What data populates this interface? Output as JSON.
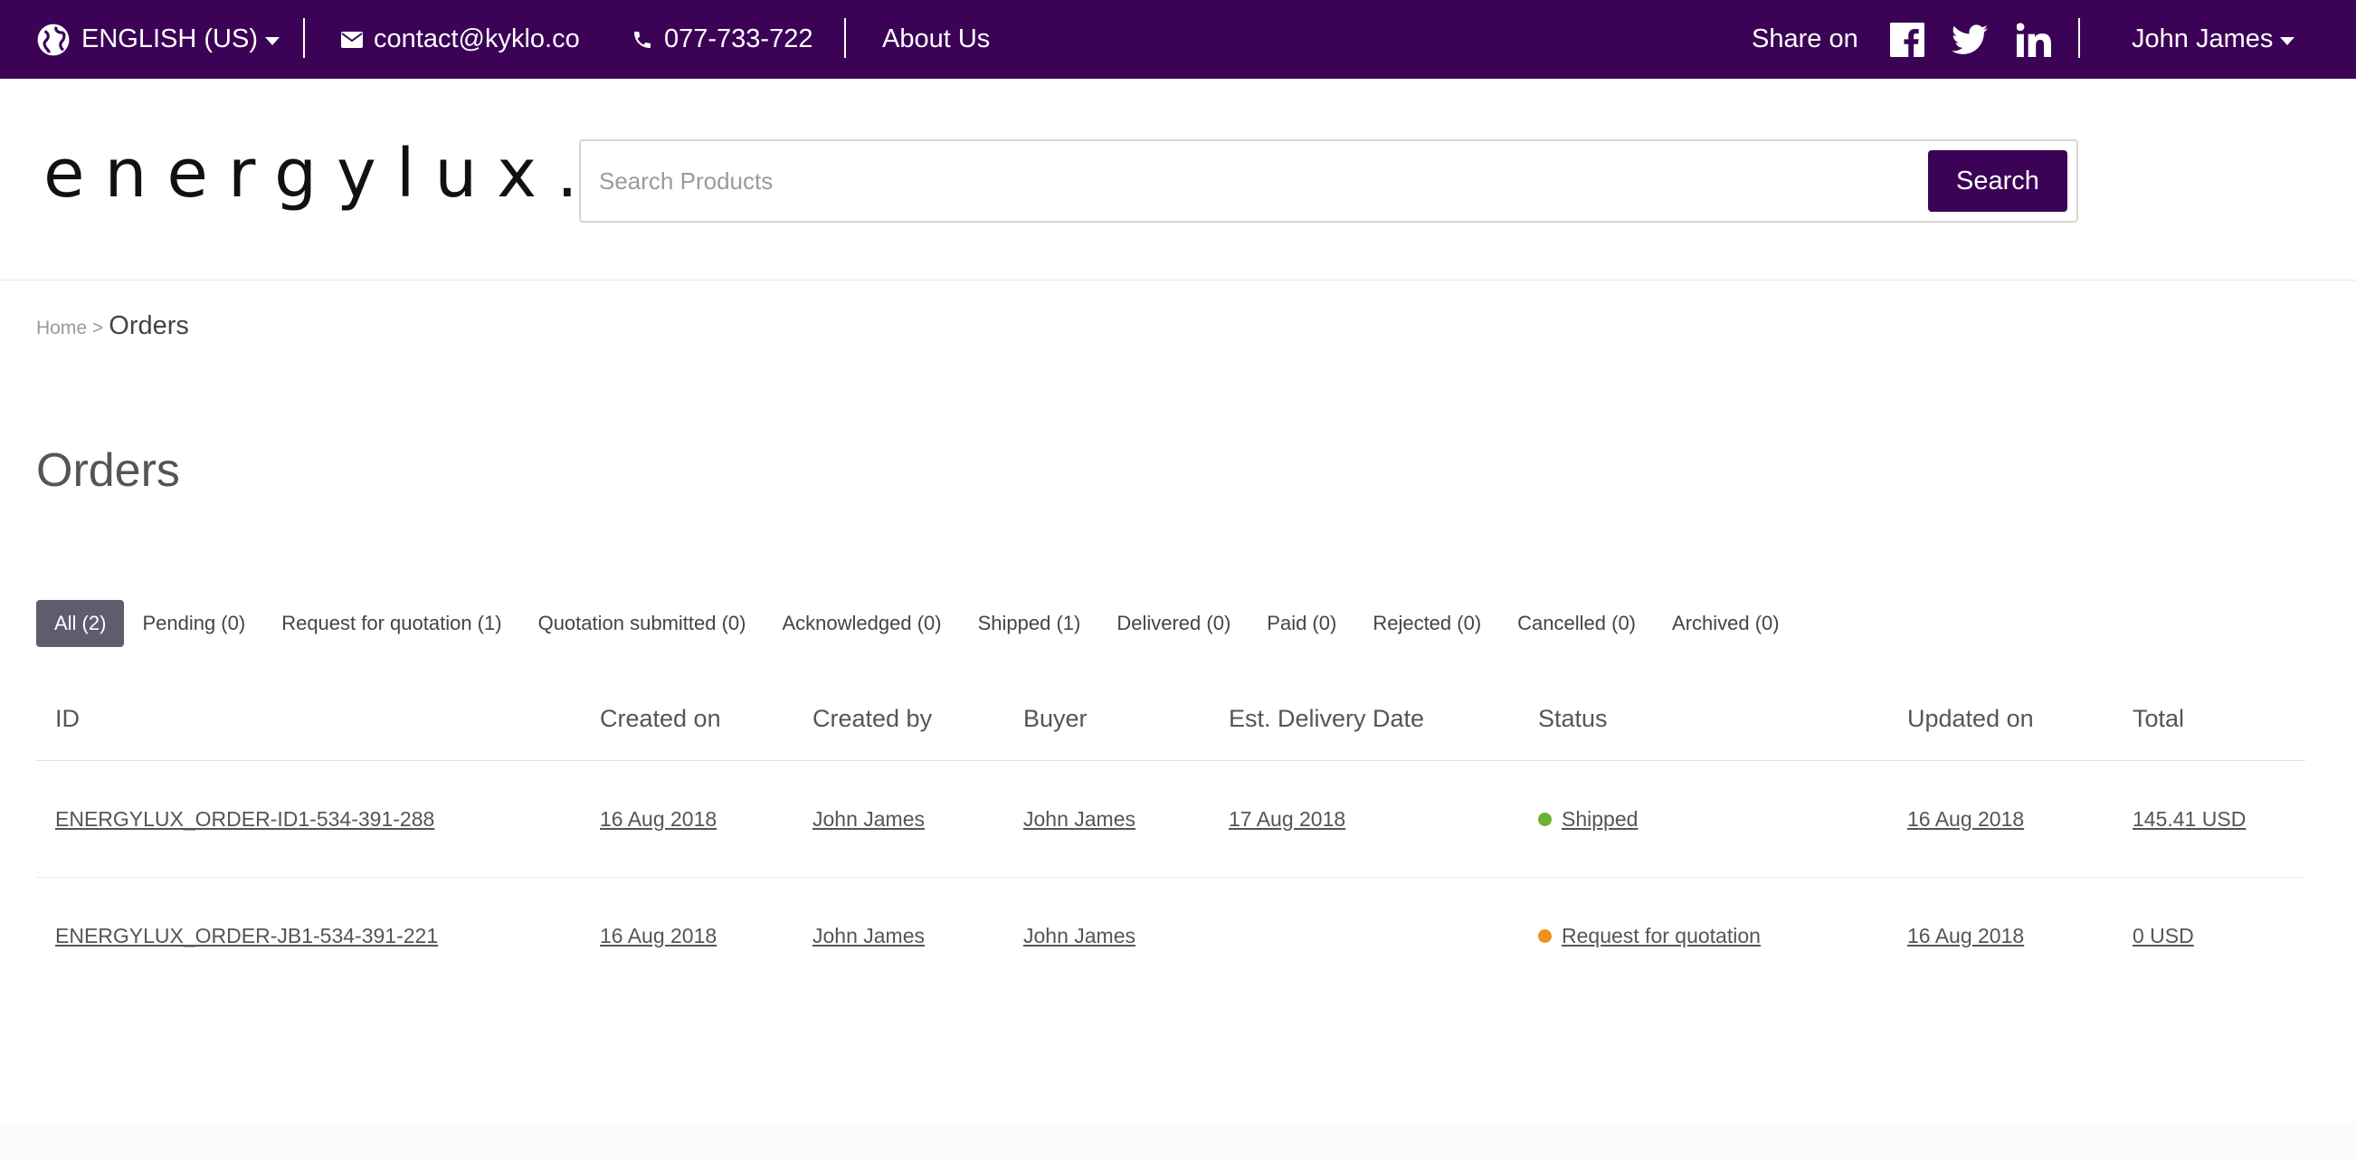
{
  "topbar": {
    "language": "ENGLISH (US)",
    "email": "contact@kyklo.co",
    "phone": "077-733-722",
    "about": "About Us",
    "share_label": "Share on",
    "user": "John James"
  },
  "header": {
    "logo": "energylux.",
    "search_placeholder": "Search Products",
    "search_button": "Search"
  },
  "breadcrumb": {
    "home": "Home",
    "separator": ">",
    "current": "Orders"
  },
  "page_title": "Orders",
  "tabs": [
    {
      "label": "All (2)",
      "active": true
    },
    {
      "label": "Pending (0)"
    },
    {
      "label": "Request for quotation (1)"
    },
    {
      "label": "Quotation submitted (0)"
    },
    {
      "label": "Acknowledged (0)"
    },
    {
      "label": "Shipped (1)"
    },
    {
      "label": "Delivered (0)"
    },
    {
      "label": "Paid (0)"
    },
    {
      "label": "Rejected (0)"
    },
    {
      "label": "Cancelled (0)"
    },
    {
      "label": "Archived (0)"
    }
  ],
  "table": {
    "columns": [
      "ID",
      "Created on",
      "Created by",
      "Buyer",
      "Est. Delivery Date",
      "Status",
      "Updated on",
      "Total"
    ],
    "rows": [
      {
        "id": "ENERGYLUX_ORDER-ID1-534-391-288",
        "created_on": "16 Aug 2018",
        "created_by": "John James",
        "buyer": "John James",
        "est_delivery": "17 Aug 2018",
        "status": "Shipped",
        "status_color": "#6ab233",
        "updated_on": "16 Aug 2018",
        "total": "145.41 USD"
      },
      {
        "id": "ENERGYLUX_ORDER-JB1-534-391-221",
        "created_on": "16 Aug 2018",
        "created_by": "John James",
        "buyer": "John James",
        "est_delivery": "",
        "status": "Request for quotation",
        "status_color": "#f0901e",
        "updated_on": "16 Aug 2018",
        "total": "0 USD"
      }
    ]
  },
  "colors": {
    "brand": "#3b0256",
    "active_tab": "#5f5c6e"
  },
  "icons": [
    "globe-icon",
    "mail-icon",
    "phone-icon",
    "facebook-icon",
    "twitter-icon",
    "linkedin-icon",
    "chevron-down-icon"
  ]
}
